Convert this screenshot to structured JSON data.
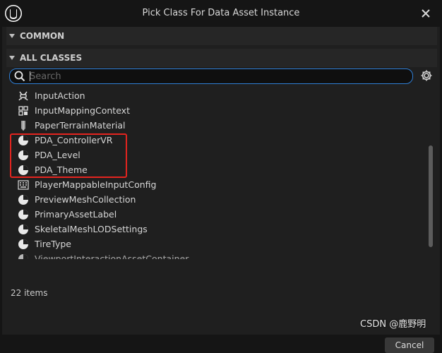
{
  "window": {
    "title": "Pick Class For Data Asset Instance",
    "logo_icon": "unreal-engine-logo",
    "close_icon": "close-icon"
  },
  "sections": {
    "common": "COMMON",
    "all_classes": "ALL CLASSES"
  },
  "search": {
    "placeholder": "Search",
    "value": ""
  },
  "items": [
    {
      "label": "InputAction",
      "icon": "input-action-icon"
    },
    {
      "label": "InputMappingContext",
      "icon": "input-mapping-icon"
    },
    {
      "label": "PaperTerrainMaterial",
      "icon": "paper-terrain-icon"
    },
    {
      "label": "PDA_ControllerVR",
      "icon": "data-asset-icon"
    },
    {
      "label": "PDA_Level",
      "icon": "data-asset-icon"
    },
    {
      "label": "PDA_Theme",
      "icon": "data-asset-icon"
    },
    {
      "label": "PlayerMappableInputConfig",
      "icon": "input-config-icon"
    },
    {
      "label": "PreviewMeshCollection",
      "icon": "data-asset-icon"
    },
    {
      "label": "PrimaryAssetLabel",
      "icon": "data-asset-icon"
    },
    {
      "label": "SkeletalMeshLODSettings",
      "icon": "data-asset-icon"
    },
    {
      "label": "TireType",
      "icon": "data-asset-icon"
    },
    {
      "label": "ViewportInteractionAssetContainer",
      "icon": "data-asset-icon"
    }
  ],
  "status": {
    "item_count": "22 items"
  },
  "buttons": {
    "cancel": "Cancel"
  },
  "watermark": "CSDN @鹿野明",
  "colors": {
    "accent": "#2f7fd6",
    "highlight": "#e4241f",
    "background": "#1f1f1f"
  }
}
